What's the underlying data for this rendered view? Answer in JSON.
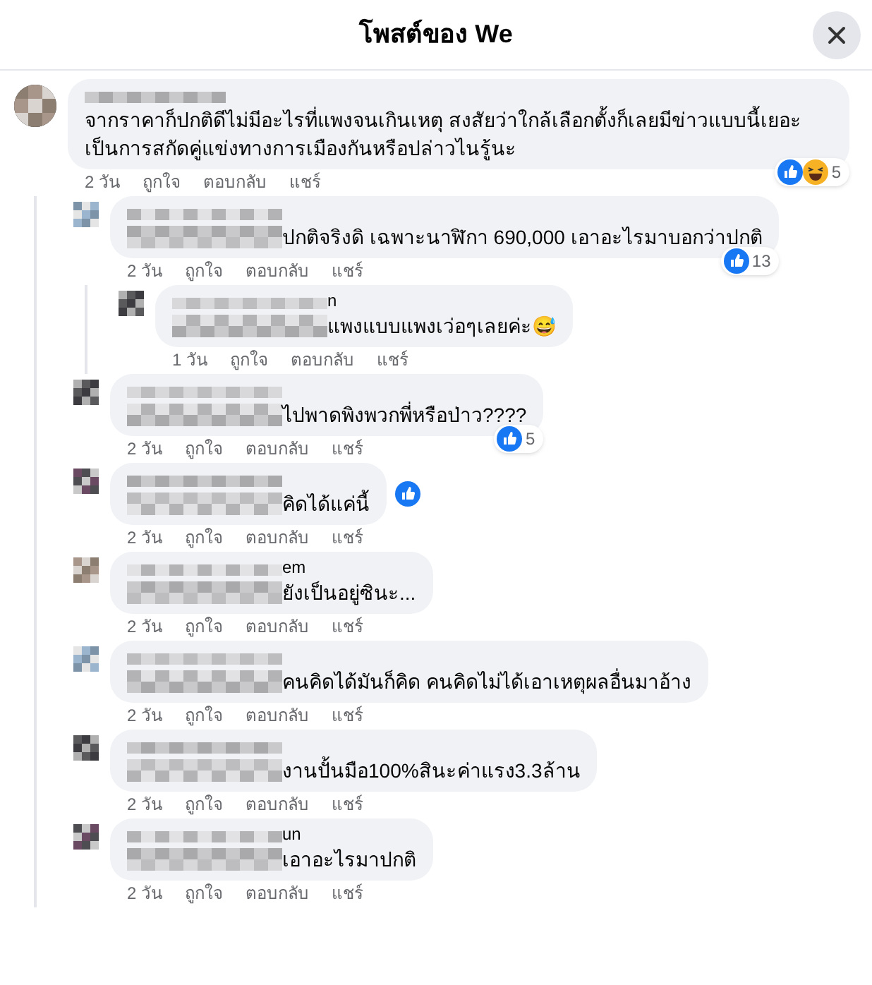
{
  "header": {
    "title": "โพสต์ของ We"
  },
  "comments": [
    {
      "text": "จากราคาก็ปกติดีไม่มีอะไรที่แพงจนเกินเหตุ สงสัยว่าใกล้เลือกตั้งก็เลยมีข่าวแบบนี้เยอะ เป็นการสกัดคู่แข่งทางการเมืองกันหรือปล่าวไนรู้นะ",
      "time": "2 วัน",
      "actions": [
        "ถูกใจ",
        "ตอบกลับ",
        "แชร์"
      ],
      "reactions": [
        {
          "kind": "like"
        },
        {
          "kind": "haha"
        }
      ],
      "reaction_count": "5",
      "children": [
        {
          "text": "ปกติจริงดิ เฉพาะนาฬิกา 690,000 เอาอะไรมาบอกว่าปกติ",
          "time": "2 วัน",
          "actions": [
            "ถูกใจ",
            "ตอบกลับ",
            "แชร์"
          ],
          "reactions": [
            {
              "kind": "like"
            }
          ],
          "reaction_count": "13",
          "children": [
            {
              "name_tail": "n",
              "text": "แพงแบบแพงเว่อๆเลยค่ะ😅",
              "time": "1 วัน",
              "actions": [
                "ถูกใจ",
                "ตอบกลับ",
                "แชร์"
              ]
            }
          ]
        },
        {
          "text": "ไปพาดพิงพวกพี่หรือป่าว????",
          "time": "2 วัน",
          "actions": [
            "ถูกใจ",
            "ตอบกลับ",
            "แชร์"
          ],
          "reactions": [
            {
              "kind": "like"
            }
          ],
          "reaction_count": "5"
        },
        {
          "text": "คิดได้แค่นี้",
          "time": "2 วัน",
          "actions": [
            "ถูกใจ",
            "ตอบกลับ",
            "แชร์"
          ],
          "inline_reactions": [
            {
              "kind": "like"
            }
          ]
        },
        {
          "name_tail": "em",
          "text": "ยังเป็นอยู่ซินะ...",
          "time": "2 วัน",
          "actions": [
            "ถูกใจ",
            "ตอบกลับ",
            "แชร์"
          ]
        },
        {
          "text": "คนคิดได้มันก็คิด คนคิดไม่ได้เอาเหตุผลอื่นมาอ้าง",
          "time": "2 วัน",
          "actions": [
            "ถูกใจ",
            "ตอบกลับ",
            "แชร์"
          ]
        },
        {
          "text": "งานปั้นมือ100%สินะค่าแรง3.3ล้าน",
          "time": "2 วัน",
          "actions": [
            "ถูกใจ",
            "ตอบกลับ",
            "แชร์"
          ]
        },
        {
          "name_tail": "un",
          "text": "เอาอะไรมาปกติ",
          "time": "2 วัน",
          "actions": [
            "ถูกใจ",
            "ตอบกลับ",
            "แชร์"
          ]
        }
      ]
    }
  ]
}
